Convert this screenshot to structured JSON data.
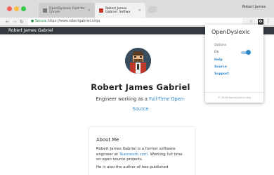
{
  "browser": {
    "tabs": [
      {
        "label": "OpenDyslexic Font for Chrom"
      },
      {
        "label": "Robert James Gabriel: Softwa"
      }
    ],
    "profile_name": "Robert James",
    "url_secure_label": "Secure",
    "url": "https://www.robertgabriel.ninja"
  },
  "site": {
    "header_name": "Robert James Gabriel",
    "name": "Robert James Gabriel",
    "tagline_prefix": "Engineer working as a ",
    "tagline_link": "Full-Time Open-",
    "tagline_link2": "Source",
    "about": {
      "title": "About Me",
      "p1_before": "Robert James Gabriel is a former software engineer at ",
      "p1_link": "Teamwork.com",
      "p1_after": ". Working full time on open source projects.",
      "p2": "He is also the author of two published"
    }
  },
  "popup": {
    "title": "OpenDyslexic",
    "options_label": "Options",
    "on_label": "On",
    "toggle_on": true,
    "links": [
      "Help",
      "Source",
      "Support"
    ],
    "footer": "© 2018 OpenDyslexic.org"
  },
  "colors": {
    "header_bg": "#343a40",
    "accent": "#2f86c9"
  }
}
